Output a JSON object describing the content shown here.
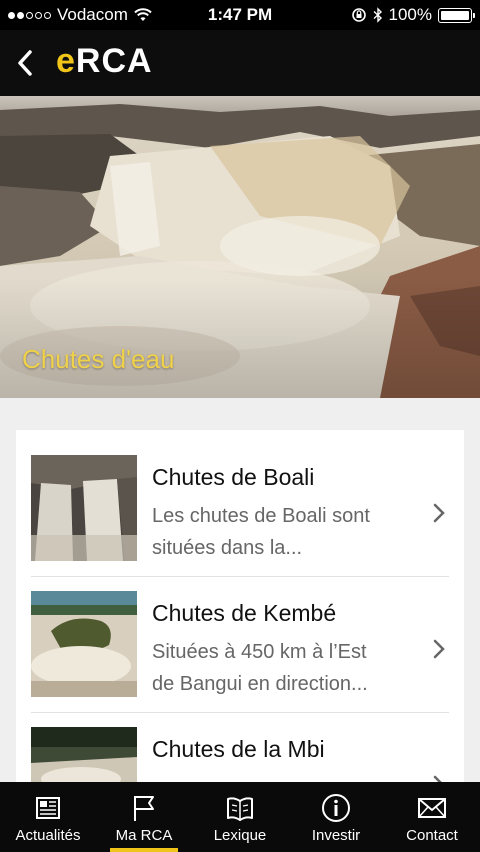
{
  "status_bar": {
    "carrier": "Vodacom",
    "time": "1:47 PM",
    "battery": "100%",
    "signal_bars_filled": 2,
    "signal_bars_total": 5
  },
  "nav": {
    "title_accent": "e",
    "title_rest": "RCA",
    "back_icon": "chevron-left-icon"
  },
  "hero": {
    "title": "Chutes d'eau"
  },
  "items": [
    {
      "title": "Chutes de Boali",
      "desc_line1": "Les chutes de Boali sont",
      "desc_line2": "situées dans la..."
    },
    {
      "title": "Chutes de Kembé",
      "desc_line1": "Situées à 450 km à l’Est",
      "desc_line2": "de Bangui en direction..."
    },
    {
      "title": "Chutes de la Mbi",
      "desc_line1": "",
      "desc_line2": ""
    }
  ],
  "tabs": [
    {
      "label": "Actualités",
      "icon": "newspaper-icon",
      "active": false
    },
    {
      "label": "Ma RCA",
      "icon": "flag-icon",
      "active": true
    },
    {
      "label": "Lexique",
      "icon": "book-icon",
      "active": false
    },
    {
      "label": "Investir",
      "icon": "info-icon",
      "active": false
    },
    {
      "label": "Contact",
      "icon": "envelope-icon",
      "active": false
    }
  ],
  "colors": {
    "accent": "#f0c419",
    "hero_title": "#f0d14a",
    "bars": "#0d0d0d"
  }
}
